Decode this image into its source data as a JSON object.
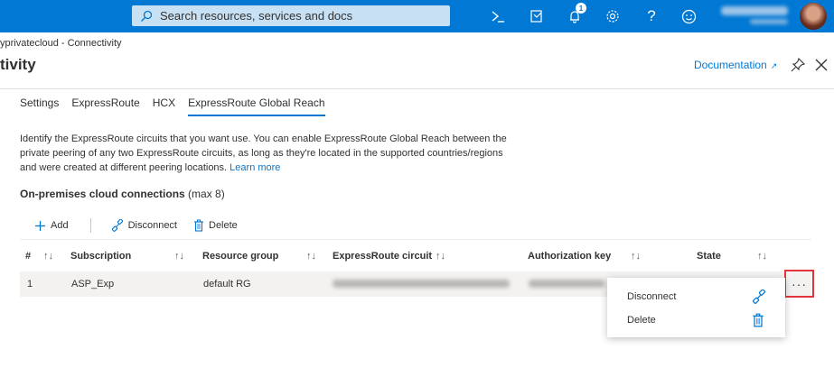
{
  "topbar": {
    "search_placeholder": "Search resources, services and docs",
    "icons": [
      "search-icon",
      "cloud-shell-icon",
      "directory-filter-icon",
      "notifications-icon",
      "settings-icon",
      "help-icon",
      "feedback-icon"
    ],
    "notification_count": "1",
    "brand_color": "#0078d4"
  },
  "breadcrumb": "yprivatecloud - Connectivity",
  "page_title": "tivity",
  "header_actions": {
    "documentation_label": "Documentation",
    "icons": [
      "external-link-icon",
      "pin-icon",
      "close-icon"
    ]
  },
  "tabs": [
    {
      "label": "Settings",
      "active": false
    },
    {
      "label": "ExpressRoute",
      "active": false
    },
    {
      "label": "HCX",
      "active": false
    },
    {
      "label": "ExpressRoute Global Reach",
      "active": true
    }
  ],
  "description": {
    "text": "Identify the ExpressRoute circuits that you want use. You can enable ExpressRoute Global Reach between the private peering of any two ExpressRoute circuits, as long as they're located in the supported countries/regions and were created at different peering locations.",
    "link": "Learn more"
  },
  "section": {
    "title": "On-premises cloud connections",
    "suffix": "(max 8)"
  },
  "toolbar": {
    "add_label": "Add",
    "disconnect_label": "Disconnect",
    "delete_label": "Delete"
  },
  "table": {
    "columns": [
      "#",
      "Subscription",
      "Resource group",
      "ExpressRoute circuit",
      "Authorization key",
      "State"
    ],
    "rows": [
      {
        "num": "1",
        "subscription": "ASP_Exp",
        "resource_group": "default RG"
      }
    ]
  },
  "context_menu": {
    "more_label": "···",
    "items": [
      {
        "label": "Disconnect",
        "icon": "disconnect-icon"
      },
      {
        "label": "Delete",
        "icon": "trash-icon"
      }
    ]
  },
  "colors": {
    "accent": "#0078d4",
    "highlight_border": "#e3333c"
  }
}
